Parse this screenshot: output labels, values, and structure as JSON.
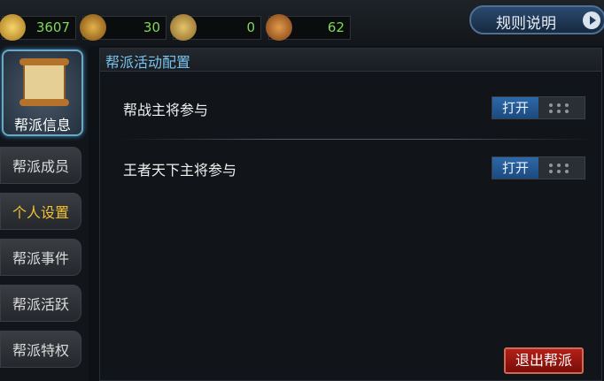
{
  "resources": [
    {
      "icon": "coin-icon",
      "value": "3607"
    },
    {
      "icon": "helmet-icon",
      "value": "30"
    },
    {
      "icon": "crossed-swords-icon",
      "value": "0"
    },
    {
      "icon": "seal-icon",
      "value": "62"
    }
  ],
  "rules_button": "规则说明",
  "sidebar": {
    "main_label": "帮派信息",
    "items": [
      {
        "label": "帮派成员"
      },
      {
        "label": "个人设置"
      },
      {
        "label": "帮派事件"
      },
      {
        "label": "帮派活跃"
      },
      {
        "label": "帮派特权"
      }
    ]
  },
  "panel": {
    "title": "帮派活动配置",
    "rows": [
      {
        "label": "帮战主将参与",
        "toggle": "打开"
      },
      {
        "label": "王者天下主将参与",
        "toggle": "打开"
      }
    ]
  },
  "quit_button": "退出帮派",
  "colors": {
    "accent": "#79c4ee",
    "active_tab": "#f2c232",
    "resource_value": "#7ed957",
    "quit": "#b22018"
  }
}
